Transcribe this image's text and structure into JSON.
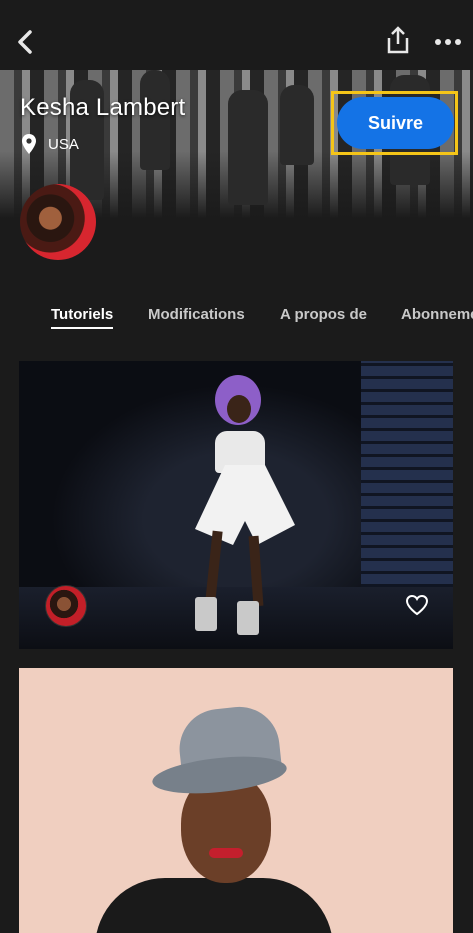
{
  "header": {
    "back_icon": "chevron-left-icon",
    "share_icon": "share-icon",
    "more_icon": "more-horizontal-icon"
  },
  "profile": {
    "name": "Kesha Lambert",
    "location_icon": "location-pin-icon",
    "location": "USA",
    "follow_label": "Suivre",
    "follow_color": "#1473e6",
    "highlight_color": "#f5c518"
  },
  "tabs": [
    {
      "label": "Tutoriels",
      "active": true
    },
    {
      "label": "Modifications",
      "active": false
    },
    {
      "label": "A propos de",
      "active": false
    },
    {
      "label": "Abonnements",
      "active": false
    }
  ],
  "cards": [
    {
      "like_icon": "heart-outline-icon"
    },
    {}
  ]
}
